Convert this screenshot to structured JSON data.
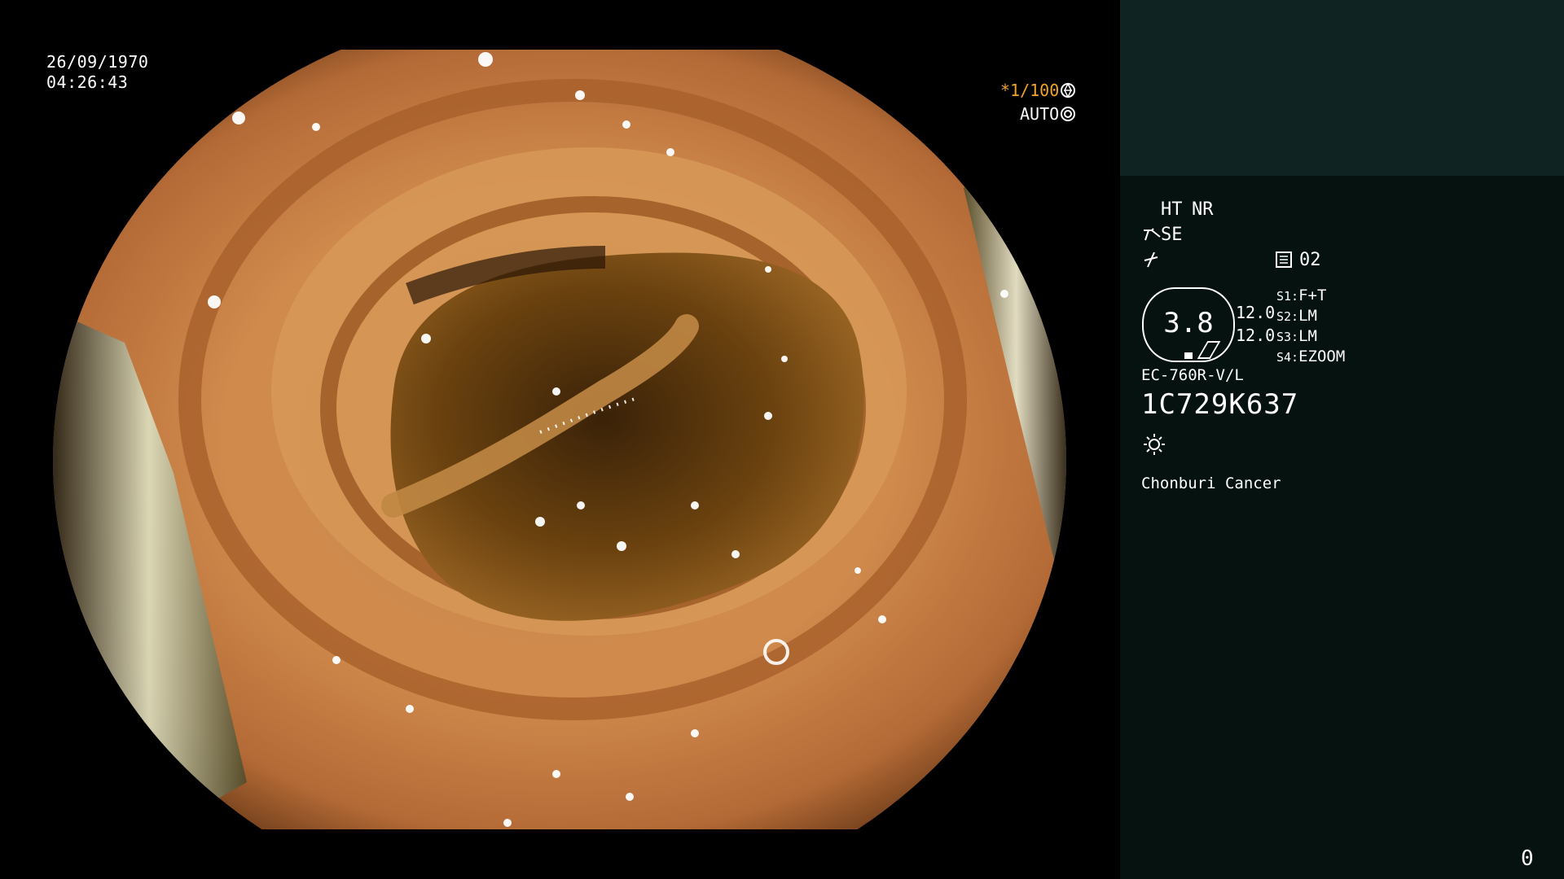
{
  "left_overlay": {
    "date": "26/09/1970",
    "time": "04:26:43",
    "shutter": "*1/100",
    "shutter_icon": "aperture-icon",
    "exposure_mode": "AUTO",
    "exposure_icon": "iris-icon"
  },
  "right_panel": {
    "ht_label": "HT",
    "nr_label": "NR",
    "se_label": "SE",
    "se_icon": "scope-icon",
    "enhance_icon": "enhance-icon",
    "memory_icon": "memory-card-icon",
    "memory_value": "02",
    "gauge_value": "3.8",
    "gauge_line1": "12.0",
    "gauge_line2": "12.0",
    "switches": [
      {
        "key": "S1:",
        "value": "F+T"
      },
      {
        "key": "S2:",
        "value": "LM"
      },
      {
        "key": "S3:",
        "value": "LM"
      },
      {
        "key": "S4:",
        "value": "EZOOM"
      }
    ],
    "scope_model": "EC-760R-V/L",
    "scope_serial": "1C729K637",
    "light_icon": "light-icon",
    "institution": "Chonburi Cancer",
    "counter": "0"
  },
  "colors": {
    "background": "#000000",
    "panel": "#061210",
    "panel_top": "#0e2322",
    "accent_orange": "#f0a22a",
    "accent_green": "#39d13d"
  }
}
